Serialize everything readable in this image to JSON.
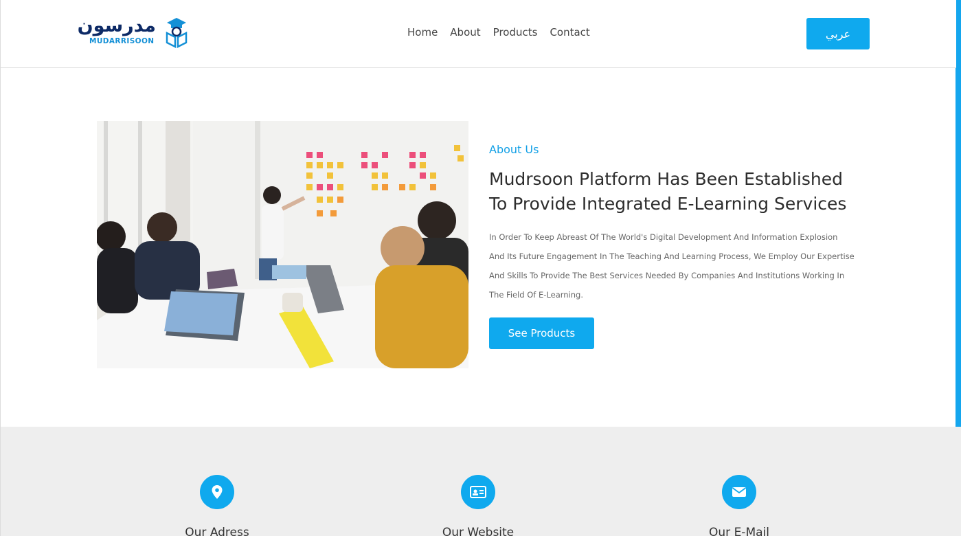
{
  "header": {
    "logo_arabic": "مدرسون",
    "logo_english": "MUDARRISOON",
    "nav": [
      "Home",
      "About",
      "Products",
      "Contact"
    ],
    "language_button": "عربي"
  },
  "about": {
    "eyebrow": "About Us",
    "headline_line1": "Mudrsoon Platform Has Been Established",
    "headline_line2": "To Provide Integrated E-Learning Services",
    "body_line1": "In Order To Keep Abreast Of The World's Digital Development And Information Explosion",
    "body_line2": "And Its Future Engagement In The Teaching And Learning Process, We Employ Our Expertise",
    "body_line3": "And Skills To Provide The Best Services Needed By Companies And Institutions Working In",
    "body_line4": "The Field Of E-Learning.",
    "cta_label": "See Products"
  },
  "contact": {
    "items": [
      {
        "label": "Our Adress",
        "icon": "map-pin-icon"
      },
      {
        "label": "Our Website",
        "icon": "id-card-icon"
      },
      {
        "label": "Our E-Mail",
        "icon": "envelope-icon"
      }
    ]
  },
  "colors": {
    "accent": "#0fa9ee",
    "brand_dark": "#0d2a66",
    "band_background": "#eeeeee"
  }
}
